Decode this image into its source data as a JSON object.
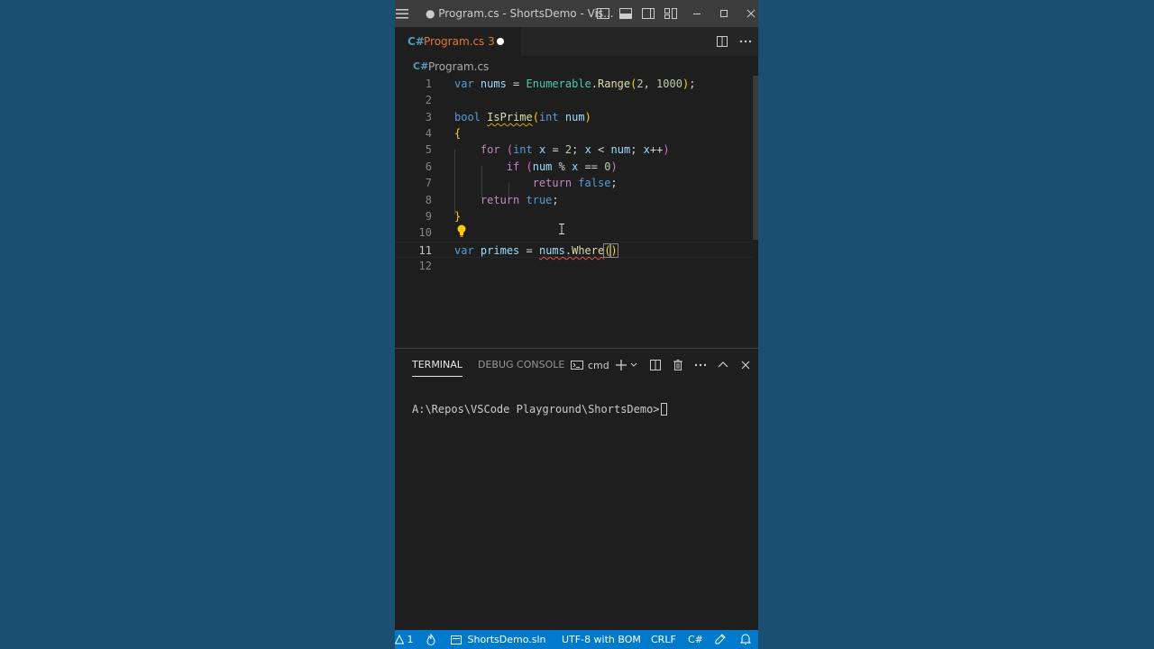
{
  "window": {
    "title": "● Program.cs - ShortsDemo - Vis..."
  },
  "tab": {
    "label": "Program.cs 3",
    "lang_badge": "C#"
  },
  "breadcrumb": {
    "file": "Program.cs"
  },
  "editor": {
    "line_numbers": [
      "1",
      "2",
      "3",
      "4",
      "5",
      "6",
      "7",
      "8",
      "9",
      "10",
      "11",
      "12"
    ],
    "active_line": "11"
  },
  "panel": {
    "tabs": [
      "TERMINAL",
      "DEBUG CONSOLE"
    ],
    "shell": "cmd",
    "prompt": "A:\\Repos\\VSCode Playground\\ShortsDemo>"
  },
  "statusbar": {
    "problems": "1",
    "solution": "ShortsDemo.sln",
    "encoding": "UTF-8 with BOM",
    "eol": "CRLF",
    "language": "C#"
  },
  "colors": {
    "background": "#1b4f72",
    "statusbar": "#007acc",
    "tab_label": "#e37933"
  }
}
